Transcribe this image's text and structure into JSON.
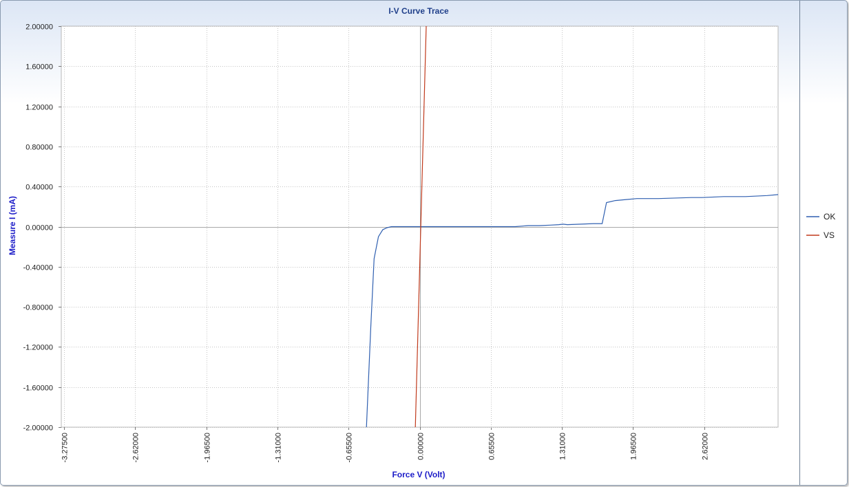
{
  "chart_data": {
    "type": "line",
    "title": "I-V Curve Trace",
    "xlabel": "Force V (Volt)",
    "ylabel": "Measure I (mA)",
    "xlim": [
      -3.3,
      3.3
    ],
    "ylim": [
      -2.0,
      2.0
    ],
    "x_ticks": [
      -3.275,
      -2.62,
      -1.965,
      -1.31,
      -0.655,
      0.0,
      0.655,
      1.31,
      1.965,
      2.62
    ],
    "x_tick_labels": [
      "-3.27500",
      "-2.62000",
      "-1.96500",
      "-1.31000",
      "-0.65500",
      "0.00000",
      "0.65500",
      "1.31000",
      "1.96500",
      "2.62000"
    ],
    "y_ticks": [
      2.0,
      1.6,
      1.2,
      0.8,
      0.4,
      0.0,
      -0.4,
      -0.8,
      -1.2,
      -1.6,
      -2.0
    ],
    "y_tick_labels": [
      "2.00000",
      "1.60000",
      "1.20000",
      "0.80000",
      "0.40000",
      "0.00000",
      "-0.40000",
      "-0.80000",
      "-1.20000",
      "-1.60000",
      "-2.00000"
    ],
    "grid": true,
    "legend_position": "right",
    "series": [
      {
        "name": "OK",
        "color": "#2f5fb0",
        "x": [
          -0.49,
          -0.45,
          -0.42,
          -0.38,
          -0.34,
          -0.3,
          -0.26,
          -0.2,
          -0.1,
          0.0,
          0.3,
          0.6,
          0.88,
          1.0,
          1.1,
          1.2,
          1.28,
          1.32,
          1.36,
          1.6,
          1.68,
          1.72,
          1.8,
          1.9,
          2.0,
          2.2,
          2.5,
          2.6,
          2.8,
          3.0,
          3.2,
          3.3
        ],
        "y": [
          -2.0,
          -1.0,
          -0.32,
          -0.1,
          -0.03,
          -0.01,
          0.0,
          0.0,
          0.0,
          0.0,
          0.0,
          0.0,
          0.0,
          0.01,
          0.01,
          0.015,
          0.02,
          0.025,
          0.02,
          0.03,
          0.03,
          0.24,
          0.26,
          0.27,
          0.28,
          0.28,
          0.29,
          0.29,
          0.3,
          0.3,
          0.31,
          0.32
        ]
      },
      {
        "name": "VS",
        "color": "#c0391b",
        "x": [
          -0.04,
          0.06
        ],
        "y": [
          -2.0,
          2.0
        ]
      }
    ]
  }
}
